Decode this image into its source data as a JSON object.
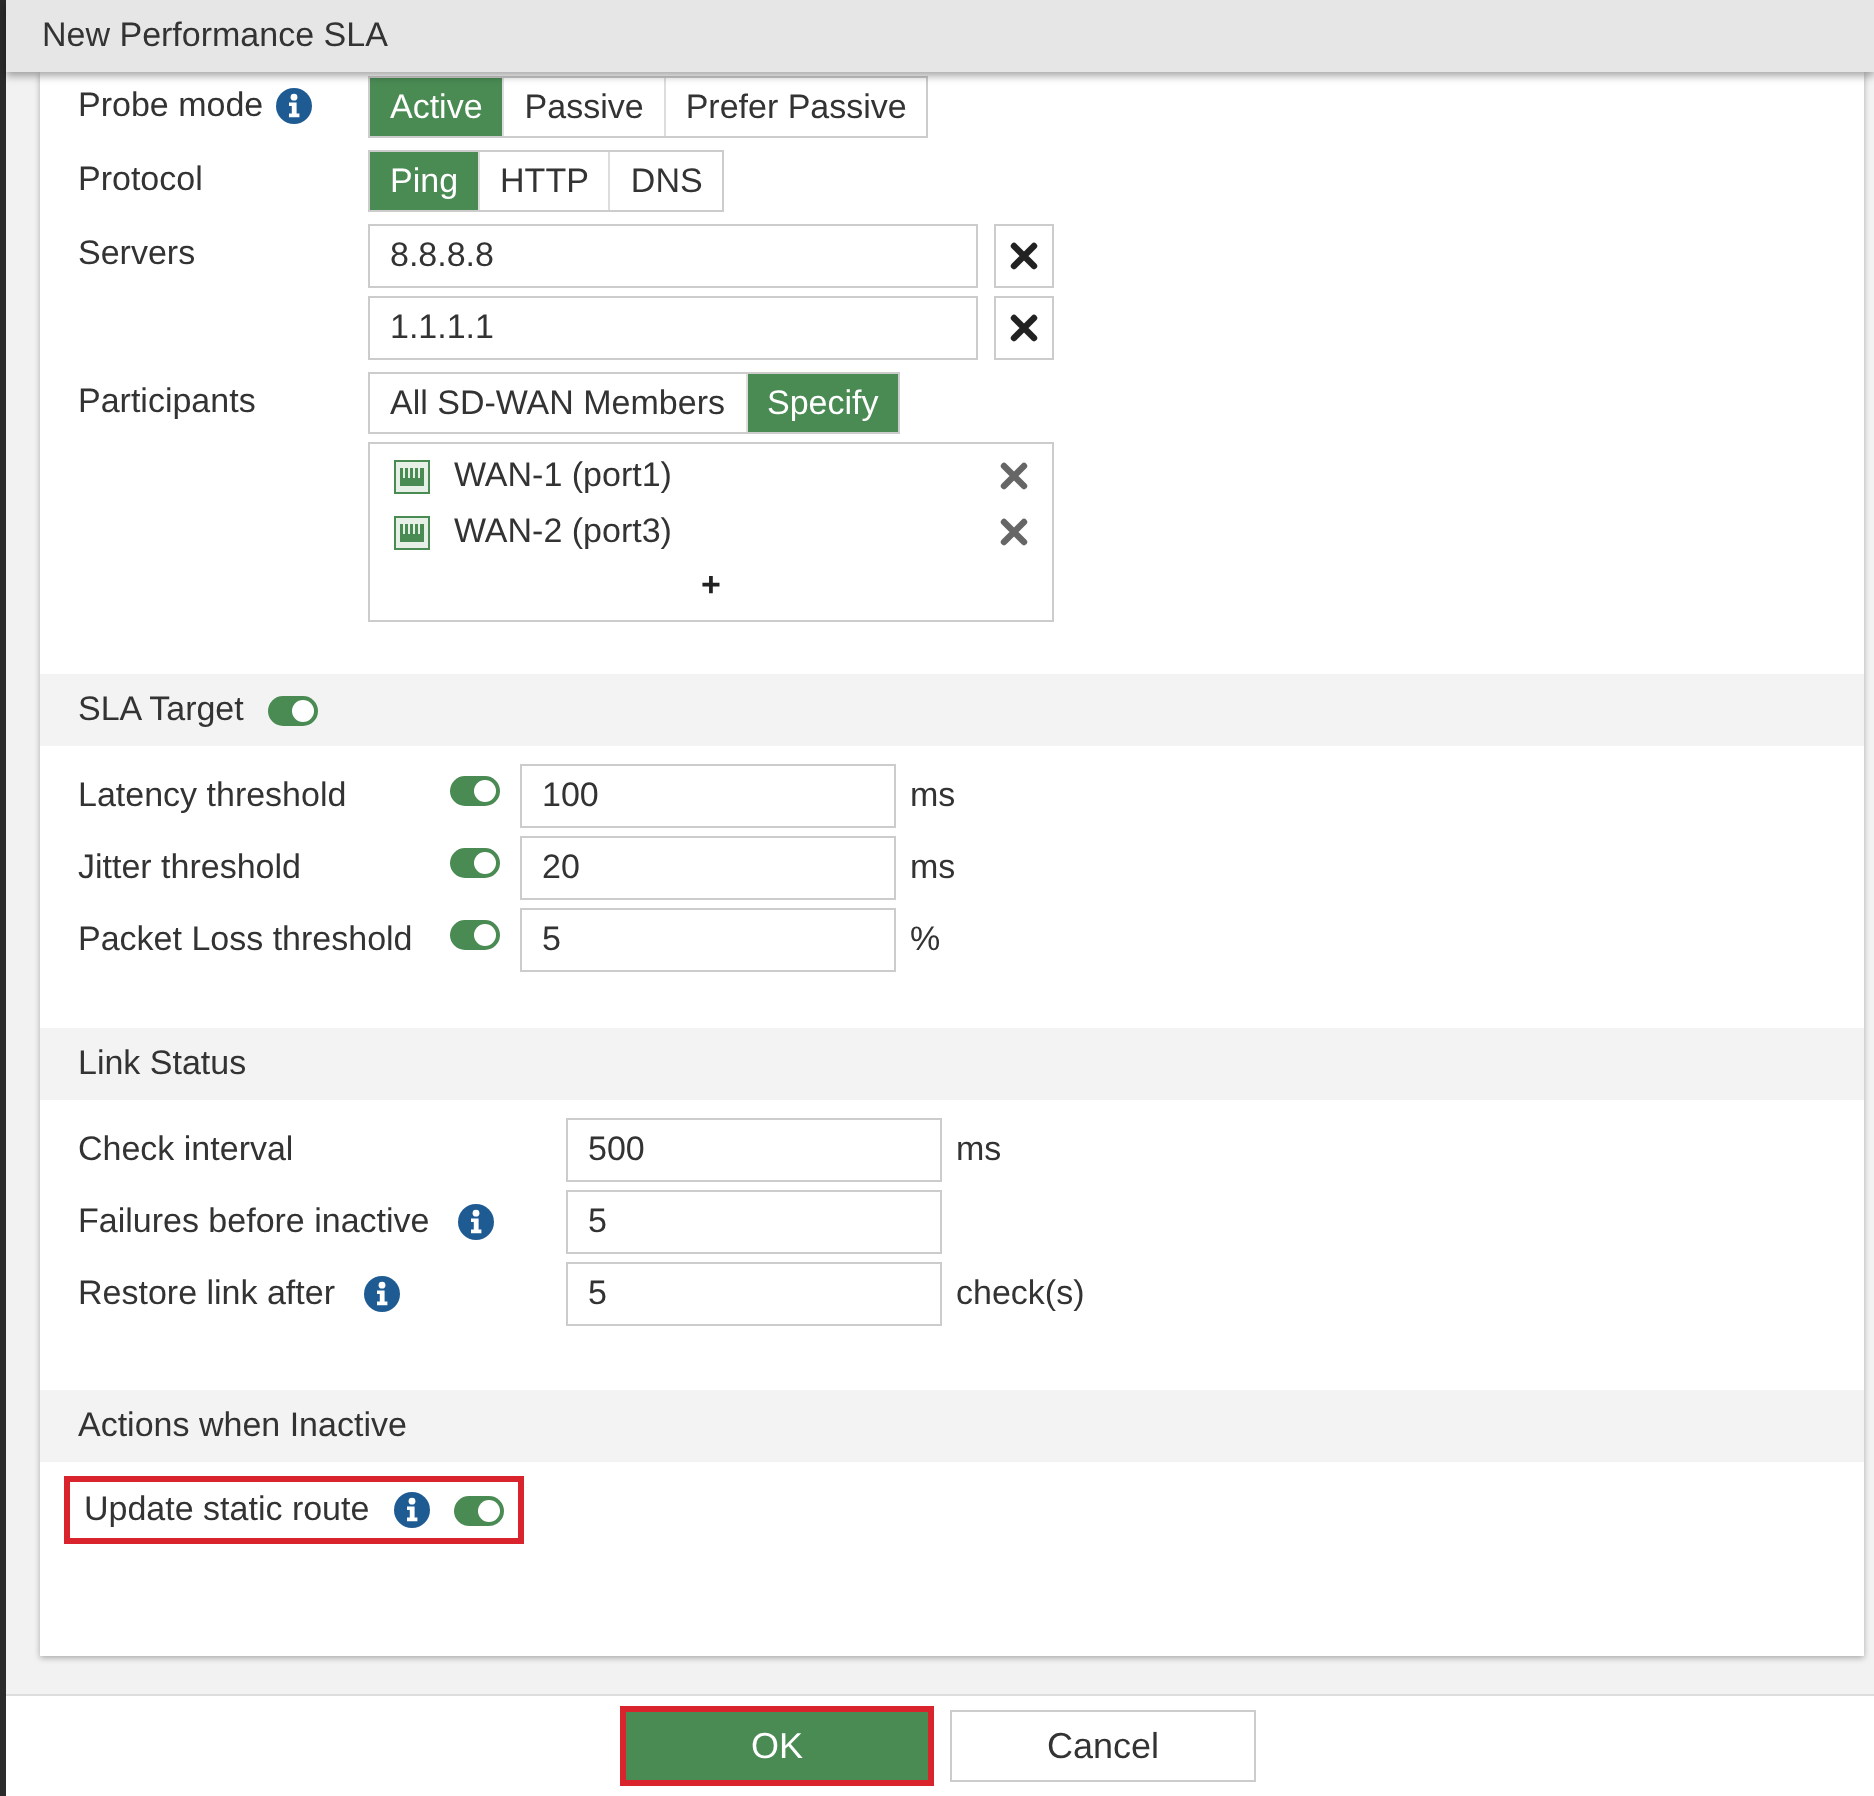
{
  "window": {
    "title": "New Performance SLA"
  },
  "general": {
    "fields": [
      {
        "kind": "segmented",
        "label": "Probe mode",
        "info": true,
        "options": [
          {
            "label": "Active",
            "selected": true
          },
          {
            "label": "Passive",
            "selected": false
          },
          {
            "label": "Prefer Passive",
            "selected": false
          }
        ]
      },
      {
        "kind": "segmented",
        "label": "Protocol",
        "info": false,
        "options": [
          {
            "label": "Ping",
            "selected": true
          },
          {
            "label": "HTTP",
            "selected": false
          },
          {
            "label": "DNS",
            "selected": false
          }
        ]
      },
      {
        "kind": "list",
        "label": "Servers",
        "info": false,
        "values": [
          "8.8.8.8",
          "1.1.1.1"
        ]
      },
      {
        "kind": "segmented",
        "label": "Participants",
        "info": false,
        "options": [
          {
            "label": "All SD-WAN Members",
            "selected": false
          },
          {
            "label": "Specify",
            "selected": true
          }
        ]
      }
    ],
    "participants": [
      {
        "label": "WAN-1 (port1)"
      },
      {
        "label": "WAN-2 (port3)"
      }
    ],
    "add_button": "+"
  },
  "sla_target": {
    "title": "SLA Target",
    "on": true,
    "thresholds": [
      {
        "label": "Latency threshold",
        "on": true,
        "value": "100",
        "unit": "ms"
      },
      {
        "label": "Jitter threshold",
        "on": true,
        "value": "20",
        "unit": "ms"
      },
      {
        "label": "Packet Loss threshold",
        "on": true,
        "value": "5",
        "unit": "%"
      }
    ]
  },
  "link_status": {
    "title": "Link Status",
    "fields": [
      {
        "label": "Check interval",
        "info": false,
        "value": "500",
        "unit": "ms"
      },
      {
        "label": "Failures before inactive",
        "info": true,
        "value": "5"
      },
      {
        "label": "Restore link after",
        "info": true,
        "value": "5",
        "unit": "check(s)"
      }
    ]
  },
  "actions": {
    "title": "Actions when Inactive",
    "items": [
      {
        "label": "Update static route",
        "info": true,
        "on": true,
        "highlighted": true
      }
    ]
  },
  "footer": {
    "buttons": [
      {
        "label": "OK",
        "kind": "primary",
        "highlighted": true
      },
      {
        "label": "Cancel",
        "kind": "secondary",
        "highlighted": false
      }
    ]
  }
}
